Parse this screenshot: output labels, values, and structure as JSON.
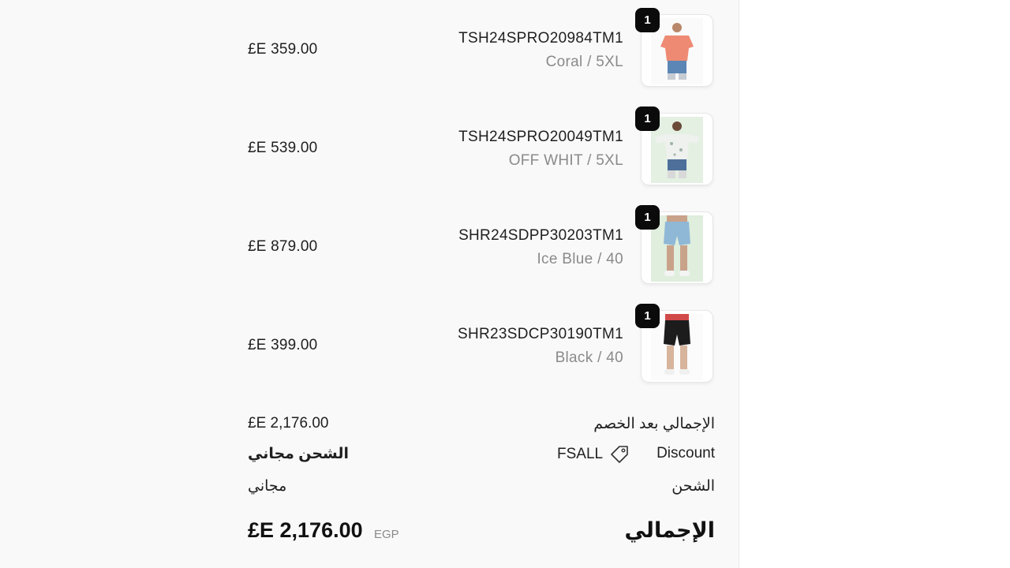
{
  "items": [
    {
      "sku": "TSH24SPRO20984TM1",
      "variant": "Coral / 5XL",
      "price": "£E 359.00",
      "quantity": "1"
    },
    {
      "sku": "TSH24SPRO20049TM1",
      "variant": "OFF WHIT / 5XL",
      "price": "£E 539.00",
      "quantity": "1"
    },
    {
      "sku": "SHR24SDPP30203TM1",
      "variant": "Ice Blue / 40",
      "price": "£E 879.00",
      "quantity": "1"
    },
    {
      "sku": "SHR23SDCP30190TM1",
      "variant": "Black / 40",
      "price": "£E 399.00",
      "quantity": "1"
    }
  ],
  "summary": {
    "subtotal_label": "الإجمالي بعد الخصم",
    "subtotal_value": "£E 2,176.00",
    "discount_label": "Discount",
    "discount_code": "FSALL",
    "discount_value": "الشحن مجاني",
    "shipping_label": "الشحن",
    "shipping_value": "مجاني",
    "total_label": "الإجمالي",
    "total_currency": "EGP",
    "total_value": "£E 2,176.00"
  },
  "colors": {
    "panel_bg": "#f9f9f9",
    "badge_bg": "#0b0b0b",
    "muted_text": "#8a8a8a"
  },
  "icons": {
    "discount": "tag-icon"
  }
}
